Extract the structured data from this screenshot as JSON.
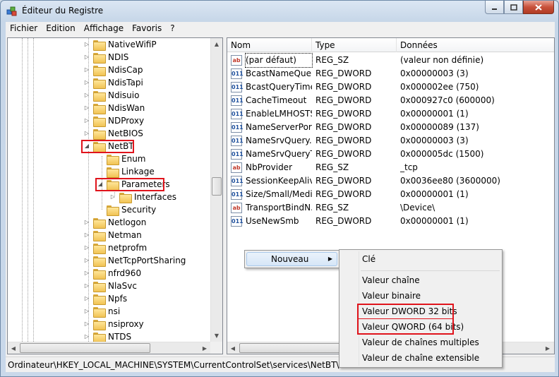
{
  "window": {
    "title": "Éditeur du Registre"
  },
  "menu": [
    "Fichier",
    "Edition",
    "Affichage",
    "Favoris",
    "?"
  ],
  "tree": {
    "items": [
      {
        "label": "NativeWifiP"
      },
      {
        "label": "NDIS"
      },
      {
        "label": "NdisCap"
      },
      {
        "label": "NdisTapi"
      },
      {
        "label": "Ndisuio"
      },
      {
        "label": "NdisWan"
      },
      {
        "label": "NDProxy"
      },
      {
        "label": "NetBIOS"
      },
      {
        "label": "NetBT",
        "expanded": true
      },
      {
        "label": "Enum"
      },
      {
        "label": "Linkage"
      },
      {
        "label": "Parameters",
        "expanded": true,
        "selected": true
      },
      {
        "label": "Interfaces"
      },
      {
        "label": "Security"
      },
      {
        "label": "Netlogon"
      },
      {
        "label": "Netman"
      },
      {
        "label": "netprofm"
      },
      {
        "label": "NetTcpPortSharing"
      },
      {
        "label": "nfrd960"
      },
      {
        "label": "NlaSvc"
      },
      {
        "label": "Npfs"
      },
      {
        "label": "nsi"
      },
      {
        "label": "nsiproxy"
      },
      {
        "label": "NTDS"
      }
    ]
  },
  "list": {
    "headers": {
      "name": "Nom",
      "type": "Type",
      "data": "Données"
    },
    "rows": [
      {
        "name": "(par défaut)",
        "type": "REG_SZ",
        "data": "(valeur non définie)",
        "icon": "string-value-icon"
      },
      {
        "name": "BcastNameQuer...",
        "type": "REG_DWORD",
        "data": "0x00000003 (3)",
        "icon": "dword-value-icon"
      },
      {
        "name": "BcastQueryTime...",
        "type": "REG_DWORD",
        "data": "0x000002ee (750)",
        "icon": "dword-value-icon"
      },
      {
        "name": "CacheTimeout",
        "type": "REG_DWORD",
        "data": "0x000927c0 (600000)",
        "icon": "dword-value-icon"
      },
      {
        "name": "EnableLMHOSTS",
        "type": "REG_DWORD",
        "data": "0x00000001 (1)",
        "icon": "dword-value-icon"
      },
      {
        "name": "NameServerPort",
        "type": "REG_DWORD",
        "data": "0x00000089 (137)",
        "icon": "dword-value-icon"
      },
      {
        "name": "NameSrvQuery...",
        "type": "REG_DWORD",
        "data": "0x00000003 (3)",
        "icon": "dword-value-icon"
      },
      {
        "name": "NameSrvQueryT...",
        "type": "REG_DWORD",
        "data": "0x000005dc (1500)",
        "icon": "dword-value-icon"
      },
      {
        "name": "NbProvider",
        "type": "REG_SZ",
        "data": "_tcp",
        "icon": "string-value-icon"
      },
      {
        "name": "SessionKeepAlive",
        "type": "REG_DWORD",
        "data": "0x0036ee80 (3600000)",
        "icon": "dword-value-icon"
      },
      {
        "name": "Size/Small/Medi...",
        "type": "REG_DWORD",
        "data": "0x00000001 (1)",
        "icon": "dword-value-icon"
      },
      {
        "name": "TransportBindN...",
        "type": "REG_SZ",
        "data": "\\Device\\",
        "icon": "string-value-icon"
      },
      {
        "name": "UseNewSmb",
        "type": "REG_DWORD",
        "data": "0x00000001 (1)",
        "icon": "dword-value-icon"
      }
    ]
  },
  "status_path": "Ordinateur\\HKEY_LOCAL_MACHINE\\SYSTEM\\CurrentControlSet\\services\\NetBT\\Paramet",
  "context_menu": {
    "new_label": "Nouveau",
    "submenu": [
      "Clé",
      "Valeur chaîne",
      "Valeur binaire",
      "Valeur DWORD 32 bits",
      "Valeur QWORD (64 bits)",
      "Valeur de chaînes multiples",
      "Valeur de chaîne extensible"
    ]
  },
  "colors": {
    "highlight_red": "#e0141c",
    "icon_string": "#c0392b",
    "icon_dword": "#1d4f9c"
  }
}
